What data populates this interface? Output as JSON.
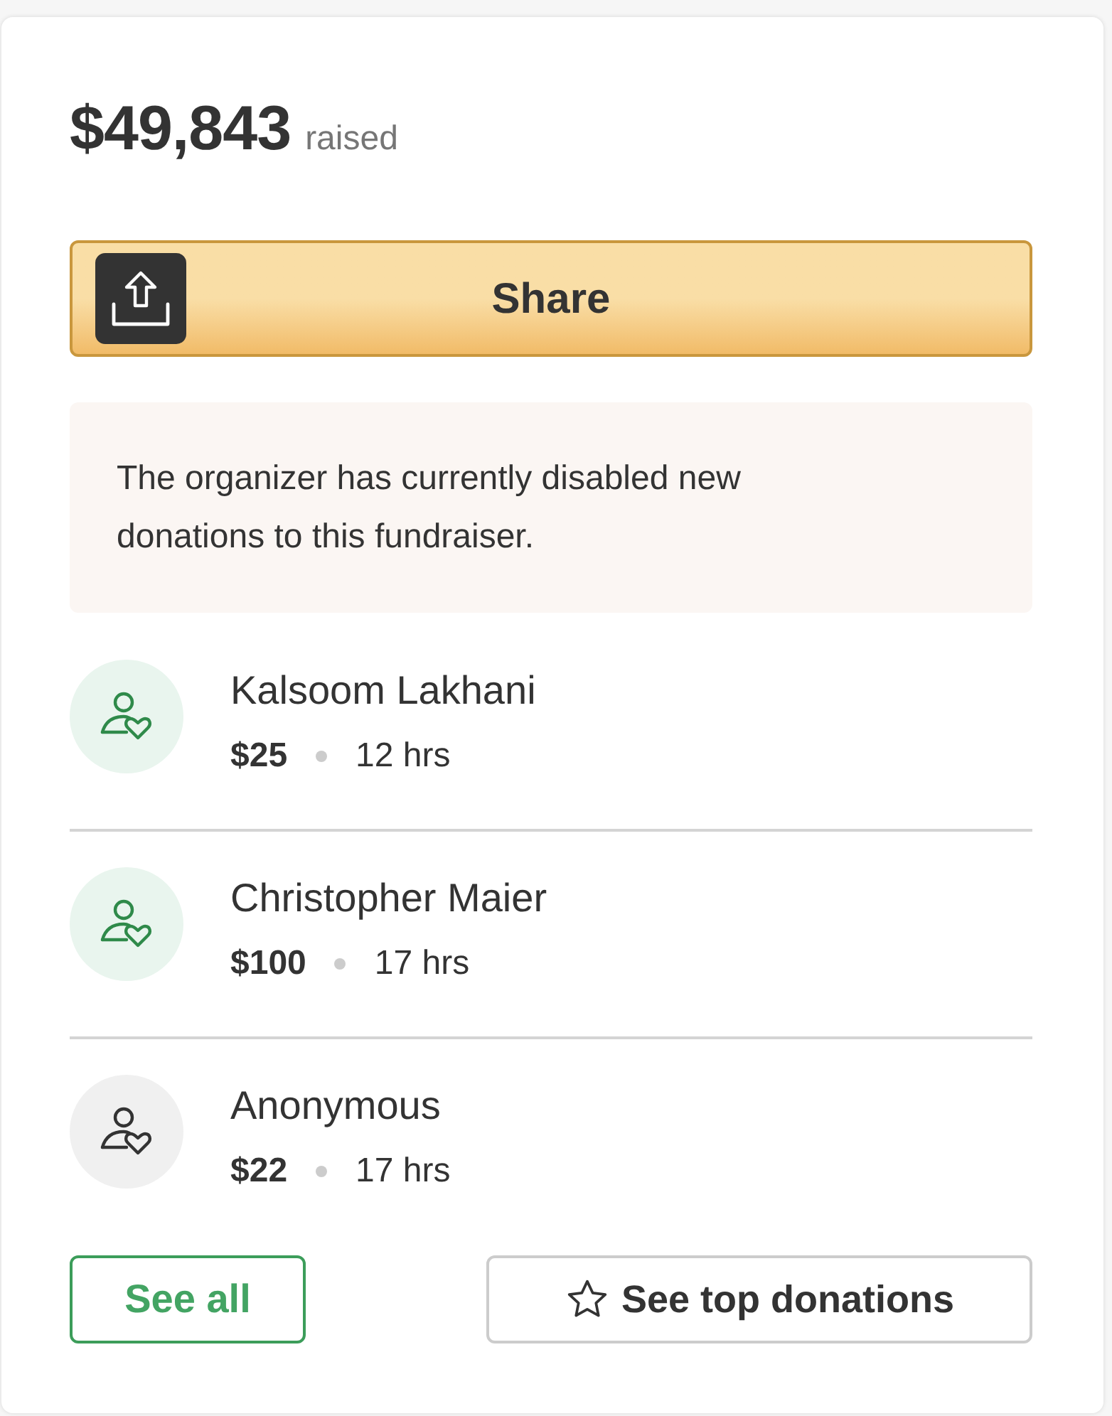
{
  "summary": {
    "amount": "$49,843",
    "label": "raised"
  },
  "share_button": {
    "label": "Share"
  },
  "notice": {
    "text": "The organizer has currently disabled new donations to this fundraiser."
  },
  "donations": [
    {
      "name": "Kalsoom Lakhani",
      "amount": "$25",
      "time": "12 hrs",
      "kind": "named"
    },
    {
      "name": "Christopher Maier",
      "amount": "$100",
      "time": "17 hrs",
      "kind": "named"
    },
    {
      "name": "Anonymous",
      "amount": "$22",
      "time": "17 hrs",
      "kind": "anonymous"
    }
  ],
  "buttons": [
    {
      "label": "See all",
      "kind": "see_all"
    },
    {
      "label": "See top donations",
      "kind": "top"
    }
  ]
}
